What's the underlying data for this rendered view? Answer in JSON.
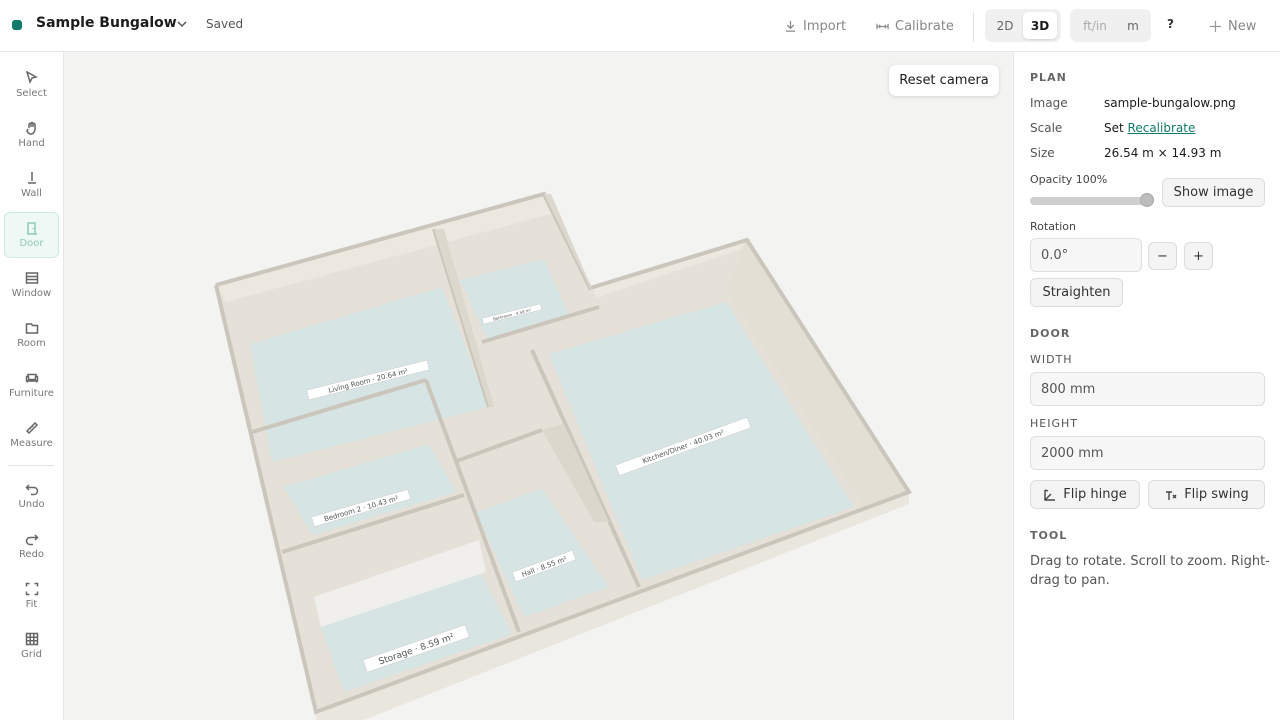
{
  "header": {
    "project_title": "Sample Bungalow",
    "save_status": "Saved",
    "import_label": "Import",
    "calibrate_label": "Calibrate",
    "view_modes": [
      "2D",
      "3D"
    ],
    "active_view": "3D",
    "units": [
      "ft/in",
      "m"
    ],
    "help_label": "?",
    "new_label": "New",
    "accent_color": "#0f7a6a"
  },
  "tools": [
    {
      "label": "Select",
      "icon": "cursor-icon"
    },
    {
      "label": "Hand",
      "icon": "hand-icon"
    },
    {
      "label": "Wall",
      "icon": "wall-icon"
    },
    {
      "label": "Door",
      "icon": "door-icon",
      "active": true
    },
    {
      "label": "Window",
      "icon": "window-icon"
    },
    {
      "label": "Room",
      "icon": "room-icon"
    },
    {
      "label": "Furniture",
      "icon": "sofa-icon"
    },
    {
      "label": "Measure",
      "icon": "ruler-icon"
    },
    {
      "label": "Undo",
      "icon": "undo-icon"
    },
    {
      "label": "Redo",
      "icon": "redo-icon"
    },
    {
      "label": "Fit",
      "icon": "fit-icon"
    },
    {
      "label": "Grid",
      "icon": "grid-icon"
    }
  ],
  "canvas": {
    "reset_camera_label": "Reset camera",
    "rooms": [
      {
        "label": "Living Room · 20.64 m²"
      },
      {
        "label": "Bathroom · 4.58 m²"
      },
      {
        "label": "Kitchen/Diner · 40.03 m²"
      },
      {
        "label": "Bedroom 2 · 10.43 m²"
      },
      {
        "label": "Hall · 8.55 m²"
      },
      {
        "label": "Storage · 8.59 m²"
      }
    ]
  },
  "panel": {
    "plan": {
      "title": "PLAN",
      "image_label": "Image",
      "image_value": "sample-bungalow.png",
      "scale_label": "Scale",
      "scale_value": "Set",
      "recalibrate_label": "Recalibrate",
      "size_label": "Size",
      "size_value": "26.54 m × 14.93 m",
      "opacity_label": "Opacity 100%",
      "opacity_value": 1.0,
      "show_image_label": "Show image",
      "rotation_label": "Rotation",
      "rotation_value": "0.0°",
      "minus_label": "−",
      "plus_label": "+",
      "straighten_label": "Straighten"
    },
    "door": {
      "title": "DOOR",
      "width_label": "WIDTH",
      "width_value": "800 mm",
      "height_label": "HEIGHT",
      "height_value": "2000 mm",
      "flip_hinge_label": "Flip hinge",
      "flip_swing_label": "Flip swing"
    },
    "tool": {
      "title": "TOOL",
      "hint": "Drag to rotate. Scroll to zoom. Right-drag to pan."
    }
  }
}
